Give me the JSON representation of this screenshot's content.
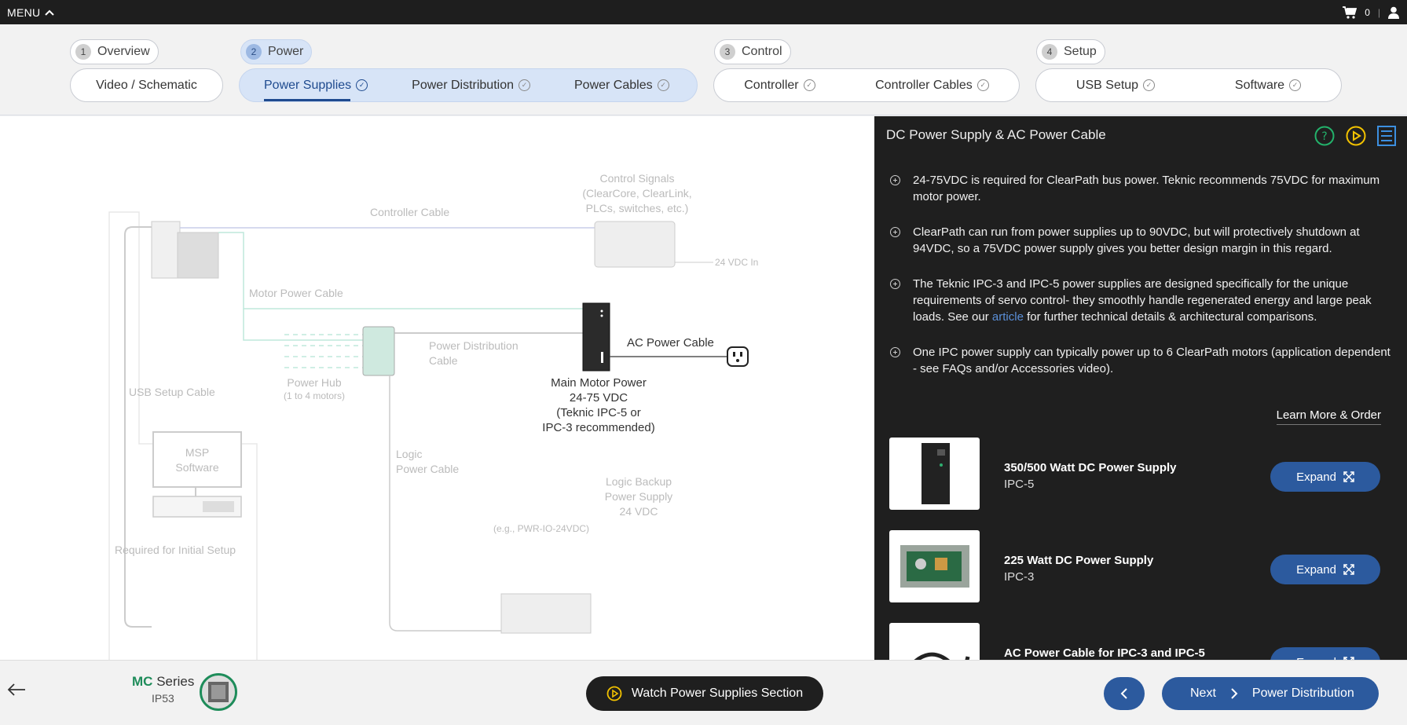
{
  "topbar": {
    "menu_label": "MENU",
    "cart_count": "0"
  },
  "steps": [
    {
      "num": "1",
      "label": "Overview"
    },
    {
      "num": "2",
      "label": "Power"
    },
    {
      "num": "3",
      "label": "Control"
    },
    {
      "num": "4",
      "label": "Setup"
    }
  ],
  "tabs": {
    "video": "Video / Schematic",
    "power_supplies": "Power Supplies",
    "power_distribution": "Power Distribution",
    "power_cables": "Power Cables",
    "controller": "Controller",
    "controller_cables": "Controller Cables",
    "usb_setup": "USB Setup",
    "software": "Software"
  },
  "diagram": {
    "control_signals": "Control Signals",
    "control_signals_sub1": "(ClearCore, ClearLink,",
    "control_signals_sub2": "PLCs, switches, etc.)",
    "controller_cable": "Controller Cable",
    "vdc_in": "24 VDC In",
    "motor_power_cable": "Motor Power Cable",
    "power_distribution_cable_1": "Power Distribution",
    "power_distribution_cable_2": "Cable",
    "ac_power_cable": "AC Power Cable",
    "power_hub": "Power Hub",
    "power_hub_sub": "(1 to 4 motors)",
    "usb_setup_cable": "USB Setup Cable",
    "main_motor_power_1": "Main Motor Power",
    "main_motor_power_2": "24-75 VDC",
    "main_motor_power_3": "(Teknic IPC-5 or",
    "main_motor_power_4": "IPC-3 recommended)",
    "msp_1": "MSP",
    "msp_2": "Software",
    "logic_power_cable_1": "Logic",
    "logic_power_cable_2": "Power Cable",
    "logic_backup_1": "Logic Backup",
    "logic_backup_2": "Power Supply",
    "logic_backup_3": "24 VDC",
    "logic_backup_eg": "(e.g., PWR-IO-24VDC)",
    "required_initial_setup": "Required for Initial Setup"
  },
  "panel": {
    "title": "DC Power Supply & AC Power Cable",
    "bullets": [
      "24-75VDC is required for ClearPath bus power. Teknic recommends 75VDC for maximum motor power.",
      "ClearPath can run from power supplies up to 90VDC, but will protectively shutdown at 94VDC, so a 75VDC power supply gives you better design margin in this regard.",
      "The Teknic IPC-3 and IPC-5 power supplies are designed specifically for the unique requirements of servo control- they smoothly handle regenerated energy and large peak loads. See our",
      "One IPC power supply can typically power up to 6 ClearPath motors (application dependent - see FAQs and/or Accessories video)."
    ],
    "bullet3_link": "article",
    "bullet3_tail": " for further technical details & architectural comparisons.",
    "learn_more": "Learn More & Order",
    "expand_label": "Expand",
    "products": [
      {
        "name": "350/500 Watt DC Power Supply",
        "code": "IPC-5"
      },
      {
        "name": "225 Watt DC Power Supply",
        "code": "IPC-3"
      },
      {
        "name": "AC Power Cable for IPC-3 and IPC-5",
        "code": ""
      }
    ]
  },
  "bottom": {
    "series_brand": "MC",
    "series_word": "Series",
    "series_code": "IP53",
    "watch_label": "Watch Power Supplies Section",
    "next_label": "Next",
    "next_target": "Power Distribution"
  },
  "colors": {
    "accent": "#2c5a9e",
    "brand_green": "#1e8c5a",
    "panel_bg": "#1f1f1f",
    "watch_icon": "#f2c200"
  }
}
